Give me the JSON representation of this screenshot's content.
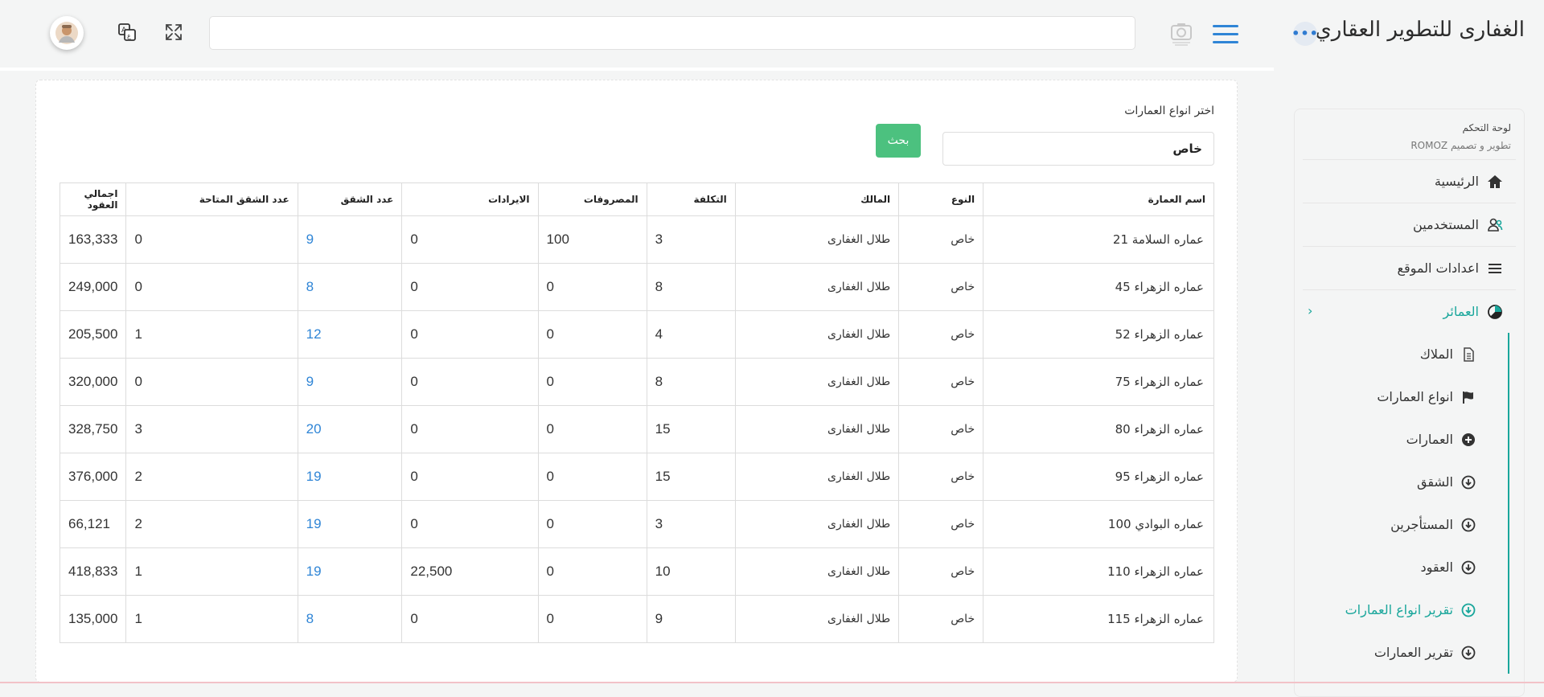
{
  "header": {
    "brand": "الغفارى للتطوير العقاري",
    "search_placeholder": ""
  },
  "sidebar": {
    "title": "لوحة التحكم",
    "subtitle": "تطوير و تصميم ROMOZ",
    "items": [
      {
        "label": "الرئيسية",
        "icon": "home-icon"
      },
      {
        "label": "المستخدمين",
        "icon": "users-icon"
      },
      {
        "label": "اعدادات الموقع",
        "icon": "list-icon"
      },
      {
        "label": "العمائر",
        "icon": "pie-chart-icon"
      }
    ],
    "subitems": [
      {
        "label": "الملاك",
        "icon": "document-icon"
      },
      {
        "label": "انواع العمارات",
        "icon": "flag-icon"
      },
      {
        "label": "العمارات",
        "icon": "plus-circle-icon"
      },
      {
        "label": "الشقق",
        "icon": "circle-down-icon"
      },
      {
        "label": "المستأجرين",
        "icon": "circle-down-icon"
      },
      {
        "label": "العقود",
        "icon": "circle-down-icon"
      },
      {
        "label": "تقرير انواع العمارات",
        "icon": "circle-down-icon"
      },
      {
        "label": "تقرير العمارات",
        "icon": "circle-down-icon"
      }
    ]
  },
  "filter": {
    "label": "اختر انواع العمارات",
    "value": "خاص",
    "button": "بحث"
  },
  "table": {
    "headers": [
      "اسم العمارة",
      "النوع",
      "المالك",
      "التكلفة",
      "المصروفات",
      "الايرادات",
      "عدد الشقق",
      "عدد الشقق المتاحة",
      "اجمالي العقود"
    ],
    "rows": [
      [
        "عماره السلامة 21",
        "خاص",
        "طلال الغفارى",
        "3",
        "100",
        "0",
        "9",
        "0",
        "163,333"
      ],
      [
        "عماره الزهراء 45",
        "خاص",
        "طلال الغفارى",
        "8",
        "0",
        "0",
        "8",
        "0",
        "249,000"
      ],
      [
        "عماره الزهراء 52",
        "خاص",
        "طلال الغفارى",
        "4",
        "0",
        "0",
        "12",
        "1",
        "205,500"
      ],
      [
        "عماره الزهراء 75",
        "خاص",
        "طلال الغفارى",
        "8",
        "0",
        "0",
        "9",
        "0",
        "320,000"
      ],
      [
        "عماره الزهراء 80",
        "خاص",
        "طلال الغفارى",
        "15",
        "0",
        "0",
        "20",
        "3",
        "328,750"
      ],
      [
        "عماره الزهراء 95",
        "خاص",
        "طلال الغفارى",
        "15",
        "0",
        "0",
        "19",
        "2",
        "376,000"
      ],
      [
        "عماره البوادي 100",
        "خاص",
        "طلال الغفارى",
        "3",
        "0",
        "0",
        "19",
        "2",
        "66,121"
      ],
      [
        "عماره الزهراء 110",
        "خاص",
        "طلال الغفارى",
        "10",
        "0",
        "22,500",
        "19",
        "1",
        "418,833"
      ],
      [
        "عماره الزهراء 115",
        "خاص",
        "طلال الغفارى",
        "9",
        "0",
        "0",
        "8",
        "1",
        "135,000"
      ]
    ]
  },
  "colors": {
    "accent": "#19a69b",
    "link": "#2f85d6",
    "button": "#4cc17f"
  }
}
